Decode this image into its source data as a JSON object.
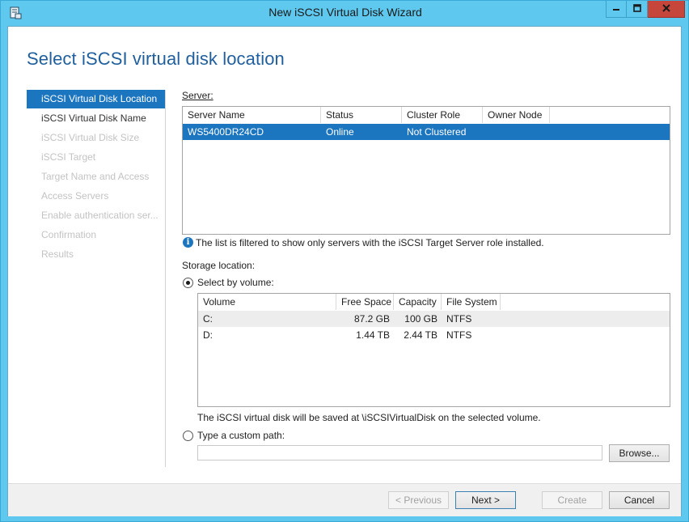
{
  "window": {
    "title": "New iSCSI Virtual Disk Wizard",
    "titlebar_color": "#5ec8ee",
    "close_color": "#c7463b"
  },
  "page": {
    "title": "Select iSCSI virtual disk location"
  },
  "nav": {
    "items": [
      {
        "label": "iSCSI Virtual Disk Location",
        "state": "active"
      },
      {
        "label": "iSCSI Virtual Disk Name",
        "state": "normal"
      },
      {
        "label": "iSCSI Virtual Disk Size",
        "state": "disabled"
      },
      {
        "label": "iSCSI Target",
        "state": "disabled"
      },
      {
        "label": "Target Name and Access",
        "state": "disabled"
      },
      {
        "label": "Access Servers",
        "state": "disabled"
      },
      {
        "label": "Enable authentication ser...",
        "state": "disabled"
      },
      {
        "label": "Confirmation",
        "state": "disabled"
      },
      {
        "label": "Results",
        "state": "disabled"
      }
    ]
  },
  "server": {
    "label": "Server:",
    "columns": [
      "Server Name",
      "Status",
      "Cluster Role",
      "Owner Node"
    ],
    "rows": [
      {
        "name": "WS5400DR24CD",
        "status": "Online",
        "cluster_role": "Not Clustered",
        "owner_node": ""
      }
    ],
    "info": "The list is filtered to show only servers with the iSCSI Target Server role installed."
  },
  "storage": {
    "label": "Storage location:",
    "select_by_volume": "Select by volume:",
    "volume_columns": [
      "Volume",
      "Free Space",
      "Capacity",
      "File System"
    ],
    "volumes": [
      {
        "volume": "C:",
        "free": "87.2 GB",
        "capacity": "100 GB",
        "fs": "NTFS"
      },
      {
        "volume": "D:",
        "free": "1.44 TB",
        "capacity": "2.44 TB",
        "fs": "NTFS"
      }
    ],
    "save_note": "The iSCSI virtual disk will be saved at \\iSCSIVirtualDisk on the selected volume.",
    "custom_path_label": "Type a custom path:",
    "custom_path_value": "",
    "browse": "Browse..."
  },
  "footer": {
    "previous": "< Previous",
    "next": "Next >",
    "create": "Create",
    "cancel": "Cancel"
  },
  "accent_color": "#1c75bf",
  "title_color": "#1f5f9e"
}
